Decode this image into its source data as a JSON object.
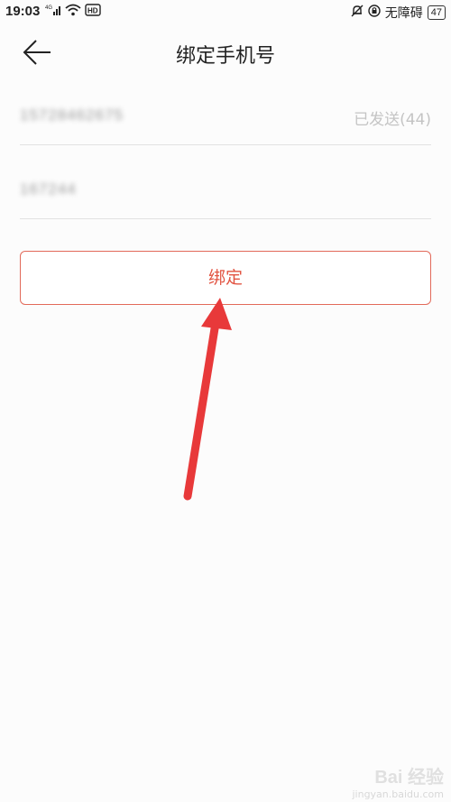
{
  "status_bar": {
    "time": "19:03",
    "network_label": "4G",
    "hd_label": "HD",
    "accessibility_label": "无障碍",
    "battery_level": "47"
  },
  "header": {
    "title": "绑定手机号"
  },
  "form": {
    "phone_value": "15728462675",
    "resend_label": "已发送(44)",
    "code_value": "167244"
  },
  "bind_button": {
    "label": "绑定"
  },
  "annotation": {
    "arrow_color": "#e8393a"
  },
  "watermark": {
    "logo": "Bai 经验",
    "url": "jingyan.baidu.com"
  }
}
